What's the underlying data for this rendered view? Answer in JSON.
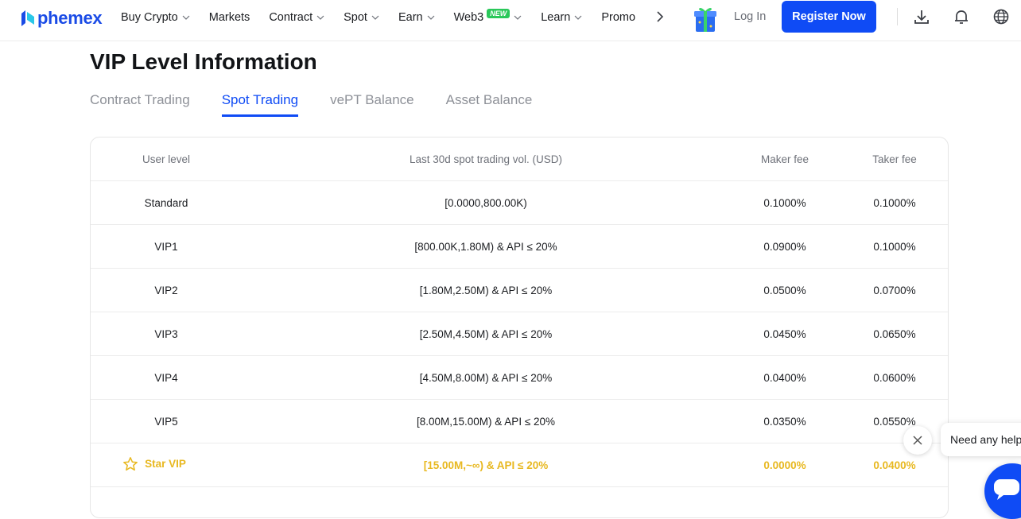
{
  "brand": {
    "name": "phemex",
    "color": "#1a4be6",
    "accent": "#0f4bf5",
    "star_color": "#e8b820"
  },
  "nav": {
    "items": [
      {
        "label": "Buy Crypto",
        "dropdown": true
      },
      {
        "label": "Markets",
        "dropdown": false
      },
      {
        "label": "Contract",
        "dropdown": true
      },
      {
        "label": "Spot",
        "dropdown": true
      },
      {
        "label": "Earn",
        "dropdown": true
      },
      {
        "label": "Web3",
        "dropdown": true,
        "badge": "NEW"
      },
      {
        "label": "Learn",
        "dropdown": true
      },
      {
        "label": "Promo",
        "dropdown": false
      }
    ],
    "login_label": "Log In",
    "register_label": "Register Now",
    "icons": [
      "gift-icon",
      "download-icon",
      "bell-icon",
      "globe-icon"
    ]
  },
  "page": {
    "title": "VIP Level Information",
    "tabs": [
      {
        "label": "Contract Trading",
        "active": false
      },
      {
        "label": "Spot Trading",
        "active": true
      },
      {
        "label": "vePT Balance",
        "active": false
      },
      {
        "label": "Asset Balance",
        "active": false
      }
    ]
  },
  "table": {
    "headers": [
      "User level",
      "Last 30d spot trading vol. (USD)",
      "Maker fee",
      "Taker fee"
    ],
    "rows": [
      {
        "level": "Standard",
        "volume": "[0.0000,800.00K)",
        "maker": "0.1000%",
        "taker": "0.1000%"
      },
      {
        "level": "VIP1",
        "volume": "[800.00K,1.80M) & API ≤ 20%",
        "maker": "0.0900%",
        "taker": "0.1000%"
      },
      {
        "level": "VIP2",
        "volume": "[1.80M,2.50M) & API ≤ 20%",
        "maker": "0.0500%",
        "taker": "0.0700%"
      },
      {
        "level": "VIP3",
        "volume": "[2.50M,4.50M) & API ≤ 20%",
        "maker": "0.0450%",
        "taker": "0.0650%"
      },
      {
        "level": "VIP4",
        "volume": "[4.50M,8.00M) & API ≤ 20%",
        "maker": "0.0400%",
        "taker": "0.0600%"
      },
      {
        "level": "VIP5",
        "volume": "[8.00M,15.00M) & API ≤ 20%",
        "maker": "0.0350%",
        "taker": "0.0550%"
      },
      {
        "level": "Star VIP",
        "volume": "[15.00M,~∞) & API ≤ 20%",
        "maker": "0.0000%",
        "taker": "0.0400%"
      }
    ]
  },
  "help": {
    "bubble_text": "Need any help"
  }
}
